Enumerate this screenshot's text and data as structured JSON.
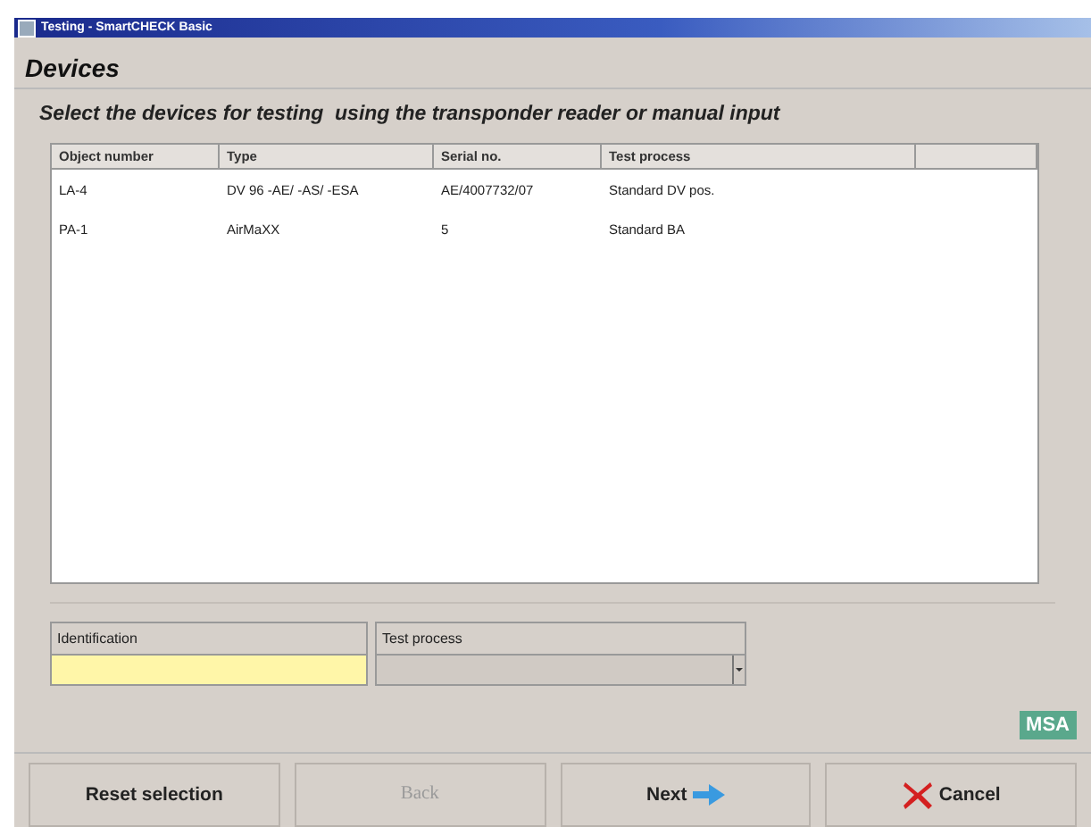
{
  "window": {
    "title": "Testing - SmartCHECK Basic"
  },
  "heading": "Devices",
  "instruction": "Select the devices for testing  using the transponder reader or manual input",
  "table": {
    "columns": [
      "Object number",
      "Type",
      "Serial no.",
      "Test process"
    ],
    "rows": [
      [
        "LA-4",
        "DV 96 -AE/ -AS/ -ESA",
        "AE/4007732/07",
        "Standard DV pos."
      ],
      [
        "PA-1",
        "AirMaXX",
        "5",
        "Standard BA"
      ]
    ]
  },
  "fields": [
    {
      "kind": "text",
      "label": "Identification"
    },
    {
      "kind": "dropdown",
      "label": "Test process"
    }
  ],
  "logo": {
    "text": "MSA"
  },
  "buttons": [
    {
      "label": "Reset selection",
      "kind": "plain",
      "disabled": false
    },
    {
      "label": "Back",
      "kind": "plain",
      "disabled": true
    },
    {
      "label": "Next",
      "kind": "forward",
      "disabled": false
    },
    {
      "label": "Cancel",
      "kind": "cancel",
      "disabled": false
    }
  ]
}
